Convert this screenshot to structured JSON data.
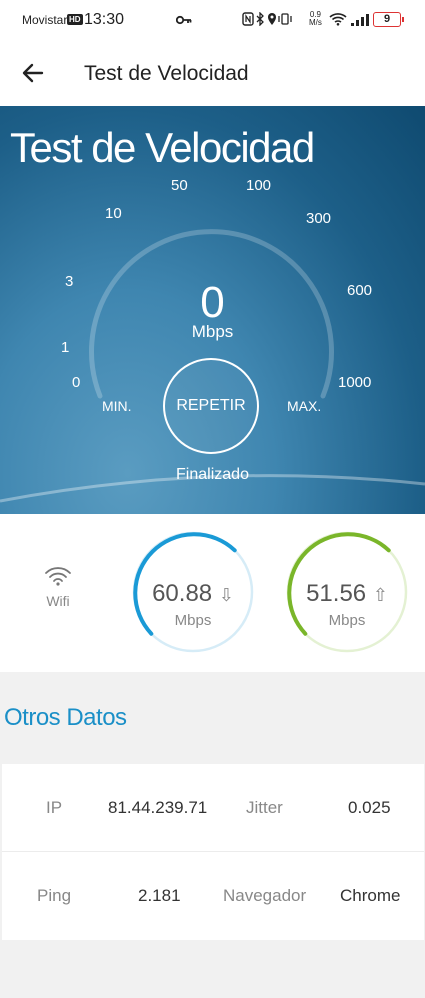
{
  "status_bar": {
    "carrier": "Movistar",
    "hd_badge": "HD",
    "time": "13:30",
    "network_speed_value": "0.9",
    "network_speed_unit": "M/s",
    "battery": "9"
  },
  "app_bar": {
    "title": "Test de Velocidad"
  },
  "hero": {
    "title": "Test de Velocidad",
    "ticks": [
      "0",
      "1",
      "3",
      "10",
      "50",
      "100",
      "300",
      "600",
      "1000"
    ],
    "value": "0",
    "unit": "Mbps",
    "min_label": "MIN.",
    "max_label": "MAX.",
    "repeat_label": "REPETIR",
    "status": "Finalizado"
  },
  "results": {
    "connection_label": "Wifi",
    "download": {
      "value": "60.88",
      "unit": "Mbps",
      "arrow": "⇩",
      "color": "#1a9ad6",
      "track_color": "#d6ecf7"
    },
    "upload": {
      "value": "51.56",
      "unit": "Mbps",
      "arrow": "⇧",
      "color": "#7ab62a",
      "track_color": "#e4f1d3"
    }
  },
  "otros_datos": {
    "heading": "Otros Datos",
    "rows": [
      {
        "k1": "IP",
        "v1": "81.44.239.71",
        "k2": "Jitter",
        "v2": "0.025"
      },
      {
        "k1": "Ping",
        "v1": "2.181",
        "k2": "Navegador",
        "v2": "Chrome"
      }
    ]
  },
  "colors": {
    "accent": "#1a8fc7",
    "hero_dark": "#0f4a70"
  }
}
